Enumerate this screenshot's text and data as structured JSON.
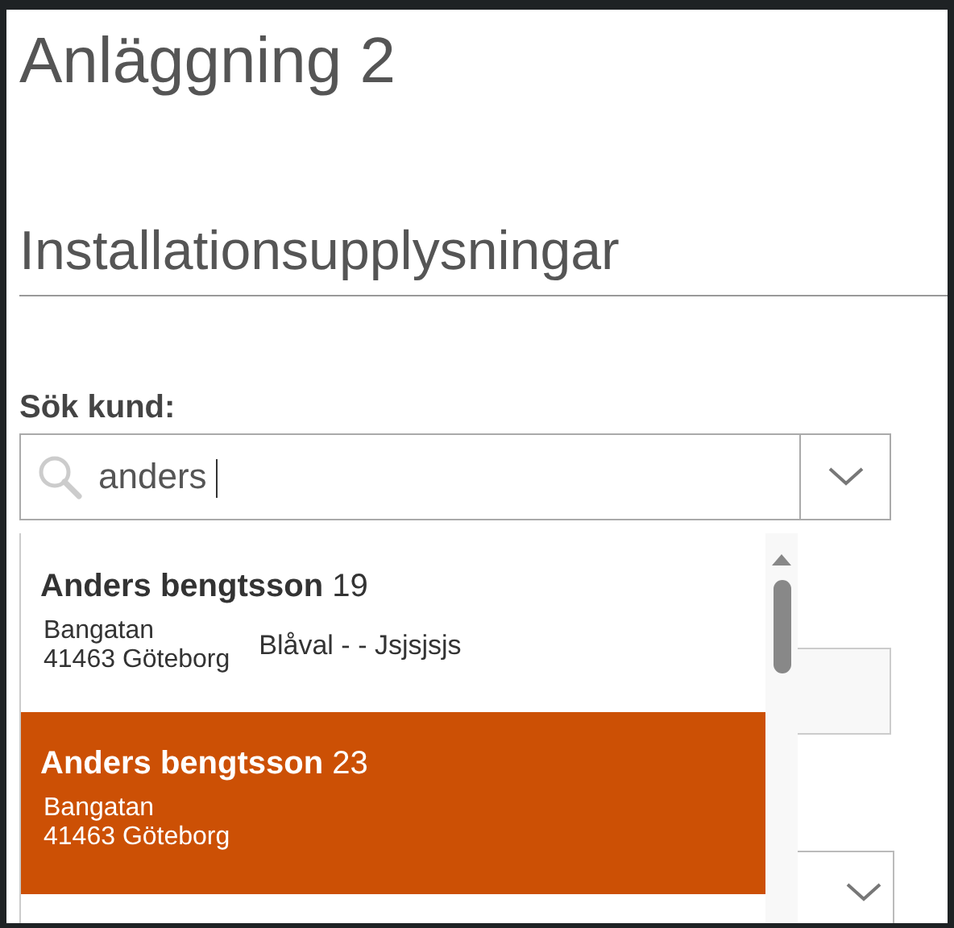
{
  "page": {
    "title": "Anläggning 2",
    "section_heading": "Installationsupplysningar"
  },
  "customer_search": {
    "label": "Sök kund:",
    "value": "anders",
    "results": [
      {
        "name": "Anders bengtsson",
        "number": "19",
        "street": "Bangatan",
        "city": "41463 Göteborg",
        "note": "Blåval - - Jsjsjsjs",
        "selected": false
      },
      {
        "name": "Anders bengtsson",
        "number": "23",
        "street": "Bangatan",
        "city": "41463 Göteborg",
        "selected": true
      }
    ]
  }
}
